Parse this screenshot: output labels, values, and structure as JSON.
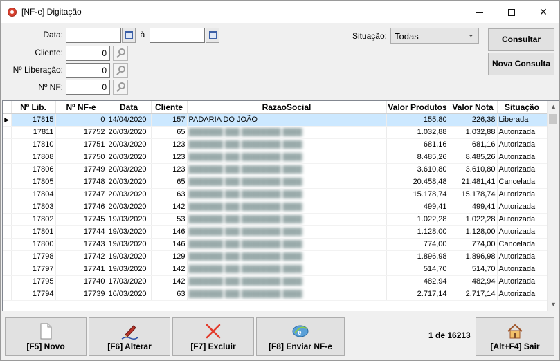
{
  "window": {
    "title": "[NF-e] Digitação"
  },
  "filters": {
    "data_label": "Data:",
    "data_sep": "à",
    "cliente_label": "Cliente:",
    "cliente_value": "0",
    "liberacao_label": "Nº Liberação:",
    "liberacao_value": "0",
    "nf_label": "Nº NF:",
    "nf_value": "0",
    "situacao_label": "Situação:",
    "situacao_value": "Todas"
  },
  "actions": {
    "consultar": "Consultar",
    "nova_consulta": "Nova Consulta"
  },
  "table": {
    "headers": [
      "Nº Lib.",
      "Nº NF-e",
      "Data",
      "Cliente",
      "RazaoSocial",
      "Valor Produtos",
      "Valor Nota",
      "Situação"
    ],
    "rows": [
      {
        "lib": "17815",
        "nfe": "0",
        "data": "14/04/2020",
        "cliente": "157",
        "razao": "PADARIA DO JOÃO",
        "vprod": "155,80",
        "vnota": "226,38",
        "sit": "Liberada"
      },
      {
        "lib": "17811",
        "nfe": "17752",
        "data": "20/03/2020",
        "cliente": "65",
        "razao": "",
        "vprod": "1.032,88",
        "vnota": "1.032,88",
        "sit": "Autorizada"
      },
      {
        "lib": "17810",
        "nfe": "17751",
        "data": "20/03/2020",
        "cliente": "123",
        "razao": "",
        "vprod": "681,16",
        "vnota": "681,16",
        "sit": "Autorizada"
      },
      {
        "lib": "17808",
        "nfe": "17750",
        "data": "20/03/2020",
        "cliente": "123",
        "razao": "",
        "vprod": "8.485,26",
        "vnota": "8.485,26",
        "sit": "Autorizada"
      },
      {
        "lib": "17806",
        "nfe": "17749",
        "data": "20/03/2020",
        "cliente": "123",
        "razao": "",
        "vprod": "3.610,80",
        "vnota": "3.610,80",
        "sit": "Autorizada"
      },
      {
        "lib": "17805",
        "nfe": "17748",
        "data": "20/03/2020",
        "cliente": "65",
        "razao": "",
        "vprod": "20.458,48",
        "vnota": "21.481,41",
        "sit": "Cancelada"
      },
      {
        "lib": "17804",
        "nfe": "17747",
        "data": "20/03/2020",
        "cliente": "63",
        "razao": "",
        "vprod": "15.178,74",
        "vnota": "15.178,74",
        "sit": "Autorizada"
      },
      {
        "lib": "17803",
        "nfe": "17746",
        "data": "20/03/2020",
        "cliente": "142",
        "razao": "",
        "vprod": "499,41",
        "vnota": "499,41",
        "sit": "Autorizada"
      },
      {
        "lib": "17802",
        "nfe": "17745",
        "data": "19/03/2020",
        "cliente": "53",
        "razao": "",
        "vprod": "1.022,28",
        "vnota": "1.022,28",
        "sit": "Autorizada"
      },
      {
        "lib": "17801",
        "nfe": "17744",
        "data": "19/03/2020",
        "cliente": "146",
        "razao": "",
        "vprod": "1.128,00",
        "vnota": "1.128,00",
        "sit": "Autorizada"
      },
      {
        "lib": "17800",
        "nfe": "17743",
        "data": "19/03/2020",
        "cliente": "146",
        "razao": "",
        "vprod": "774,00",
        "vnota": "774,00",
        "sit": "Cancelada"
      },
      {
        "lib": "17798",
        "nfe": "17742",
        "data": "19/03/2020",
        "cliente": "129",
        "razao": "",
        "vprod": "1.896,98",
        "vnota": "1.896,98",
        "sit": "Autorizada"
      },
      {
        "lib": "17797",
        "nfe": "17741",
        "data": "19/03/2020",
        "cliente": "142",
        "razao": "",
        "vprod": "514,70",
        "vnota": "514,70",
        "sit": "Autorizada"
      },
      {
        "lib": "17795",
        "nfe": "17740",
        "data": "17/03/2020",
        "cliente": "142",
        "razao": "",
        "vprod": "482,94",
        "vnota": "482,94",
        "sit": "Autorizada"
      },
      {
        "lib": "17794",
        "nfe": "17739",
        "data": "16/03/2020",
        "cliente": "63",
        "razao": "",
        "vprod": "2.717,14",
        "vnota": "2.717,14",
        "sit": "Autorizada"
      }
    ]
  },
  "toolbar": {
    "novo": "[F5] Novo",
    "alterar": "[F6] Alterar",
    "excluir": "[F7] Excluir",
    "enviar": "[F8] Enviar NF-e",
    "record_count": "1 de 16213",
    "sair": "[Alt+F4] Sair"
  },
  "icons": {
    "novo": "document-icon",
    "alterar": "pen-icon",
    "excluir": "x-delete-icon",
    "enviar": "send-nfe-icon",
    "sair": "house-icon"
  },
  "colors": {
    "selected_row": "#cce8ff",
    "excluir_red": "#e33a2a"
  }
}
